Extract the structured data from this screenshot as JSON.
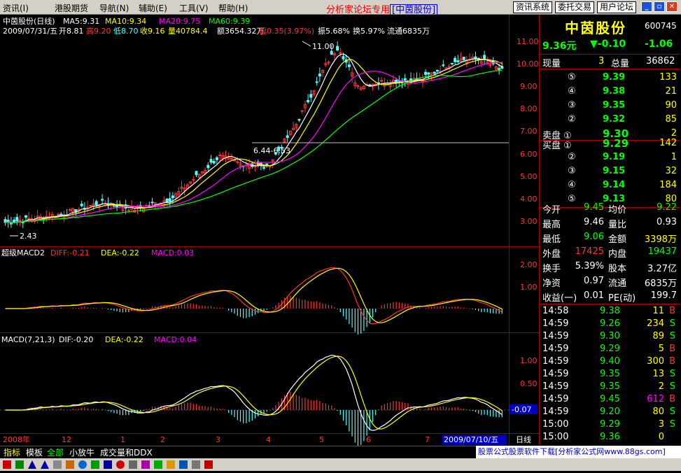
{
  "menu": {
    "items": [
      "资讯(I)",
      "港股期货",
      "导航(N)",
      "辅助(E)",
      "工具(V)",
      "帮助(H)"
    ],
    "banner": "分析家论坛专用",
    "banner_tag": "[中茵股份]",
    "tool_buttons": [
      "资讯系统",
      "委托交易",
      "用户论坛"
    ]
  },
  "header": {
    "line1": {
      "name": "中茵股份(日线)",
      "ma5": "MA5:9.31",
      "ma10": "MA10:9.34",
      "ma20": "MA20:9.75",
      "ma60": "MA60:9.39"
    },
    "line2": {
      "date": "2009/07/31/五",
      "open": "开8.81",
      "high": "高9.20",
      "low": "低8.70",
      "close": "收9.16",
      "vol": "量40784.4",
      "amount": "额3654.32万",
      "change": "幅0.35(3.97%)",
      "amplitude": "振5.68%",
      "turnover": "换5.97%",
      "float": "流通6835万"
    }
  },
  "main_axis": [
    "11.00",
    "10.00",
    "9.00",
    "8.00",
    "7.00",
    "6.00",
    "5.00",
    "4.00",
    "3.00"
  ],
  "annotations": {
    "peak": "11.00",
    "low": "2.43",
    "range": "6.44-6.53"
  },
  "macd2": {
    "title": "超级MACD2",
    "diff": "DIFF:-0.21",
    "dea": "DEA:-0.22",
    "macd": "MACD:0.03",
    "axis": [
      "2.00",
      "1.00"
    ]
  },
  "macd": {
    "title": "MACD(7,21,3)",
    "dif": "DIF:-0.20",
    "dea": "DEA:-0.22",
    "macd": "MACD:0.04",
    "axis": [
      "1.00",
      "0.50"
    ],
    "cursor": "-0.07"
  },
  "time_axis": {
    "start": "2008年",
    "labels": [
      "12",
      "1",
      "2",
      "3",
      "4",
      "5",
      "6",
      "7"
    ],
    "cursor_date": "2009/07/10/五",
    "period": "日线"
  },
  "stock": {
    "name": "中茵股份",
    "code": "600745",
    "price": "9.36元",
    "change": "▼-0.10",
    "change_pct": "-1.06",
    "current_vol_label": "现量",
    "current_vol": "3",
    "total_vol_label": "总量",
    "total_vol": "36862"
  },
  "sell_orders": [
    {
      "level": "⑤",
      "price": "9.39",
      "vol": "133"
    },
    {
      "level": "④",
      "price": "9.38",
      "vol": "21"
    },
    {
      "level": "③",
      "price": "9.35",
      "vol": "90"
    },
    {
      "level": "②",
      "price": "9.32",
      "vol": "85"
    },
    {
      "level": "卖盘 ①",
      "price": "9.30",
      "vol": "2"
    }
  ],
  "buy_orders": [
    {
      "level": "买盘 ①",
      "price": "9.29",
      "vol": "142"
    },
    {
      "level": "②",
      "price": "9.19",
      "vol": "1"
    },
    {
      "level": "③",
      "price": "9.15",
      "vol": "32"
    },
    {
      "level": "④",
      "price": "9.14",
      "vol": "184"
    },
    {
      "level": "⑤",
      "price": "9.13",
      "vol": "80"
    }
  ],
  "stats": [
    {
      "l1": "今开",
      "v1": "9.45",
      "l2": "均价",
      "v2": "9.22"
    },
    {
      "l1": "最高",
      "v1": "9.46",
      "l2": "量比",
      "v2": "0.93"
    },
    {
      "l1": "最低",
      "v1": "9.06",
      "l2": "金额",
      "v2": "3398万"
    },
    {
      "l1": "外盘",
      "v1": "17425",
      "l2": "内盘",
      "v2": "19437"
    },
    {
      "l1": "换手",
      "v1": "5.39%",
      "l2": "股本",
      "v2": "3.27亿"
    },
    {
      "l1": "净资",
      "v1": "0.97",
      "l2": "流通",
      "v2": "6835万"
    },
    {
      "l1": "收益(一)",
      "v1": "0.01",
      "l2": "PE(动)",
      "v2": "199.7"
    }
  ],
  "ticks": [
    {
      "time": "14:58",
      "price": "9.38",
      "vol": "11",
      "side": "B"
    },
    {
      "time": "14:59",
      "price": "9.26",
      "vol": "234",
      "side": "S"
    },
    {
      "time": "14:59",
      "price": "9.30",
      "vol": "89",
      "side": "S"
    },
    {
      "time": "14:59",
      "price": "9.29",
      "vol": "5",
      "side": "B"
    },
    {
      "time": "14:59",
      "price": "9.40",
      "vol": "300",
      "side": "B"
    },
    {
      "time": "14:59",
      "price": "9.35",
      "vol": "13",
      "side": "S"
    },
    {
      "time": "14:59",
      "price": "9.35",
      "vol": "2",
      "side": "S"
    },
    {
      "time": "14:59",
      "price": "9.45",
      "vol": "612",
      "side": "B"
    },
    {
      "time": "14:59",
      "price": "9.20",
      "vol": "80",
      "side": "S"
    },
    {
      "time": "15:00",
      "price": "9.29",
      "vol": "3",
      "side": "S"
    },
    {
      "time": "15:00",
      "price": "9.36",
      "vol": "0",
      "side": ""
    }
  ],
  "bottom_tabs": [
    "指标",
    "模板",
    "全部",
    "小放牛",
    "成交量和DDX"
  ],
  "ad": "股票公式股票软件下载[分析家公式网www.88gs.com]",
  "colors": {
    "up": "#ff3232",
    "down": "#54fcfc",
    "yellow": "#ffff00",
    "magenta": "#ff00ff",
    "green": "#00ff00",
    "white": "#ffffff",
    "axis": "#a00000"
  }
}
